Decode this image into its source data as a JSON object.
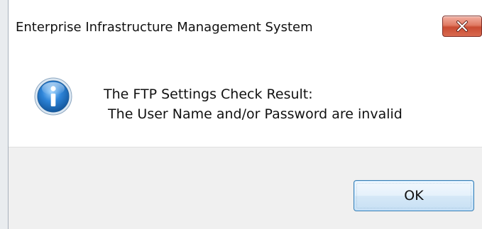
{
  "window": {
    "title": "Enterprise Infrastructure Management System"
  },
  "message": {
    "line1": "The FTP Settings Check Result:",
    "line2": " The User Name and/or Password are invalid",
    "icon": "info-icon"
  },
  "buttons": {
    "ok_label": "OK",
    "close_icon": "close-icon"
  },
  "colors": {
    "close_button": "#c94b32",
    "ok_button_border": "#3c7fb1",
    "button_area": "#f0f0f0"
  }
}
